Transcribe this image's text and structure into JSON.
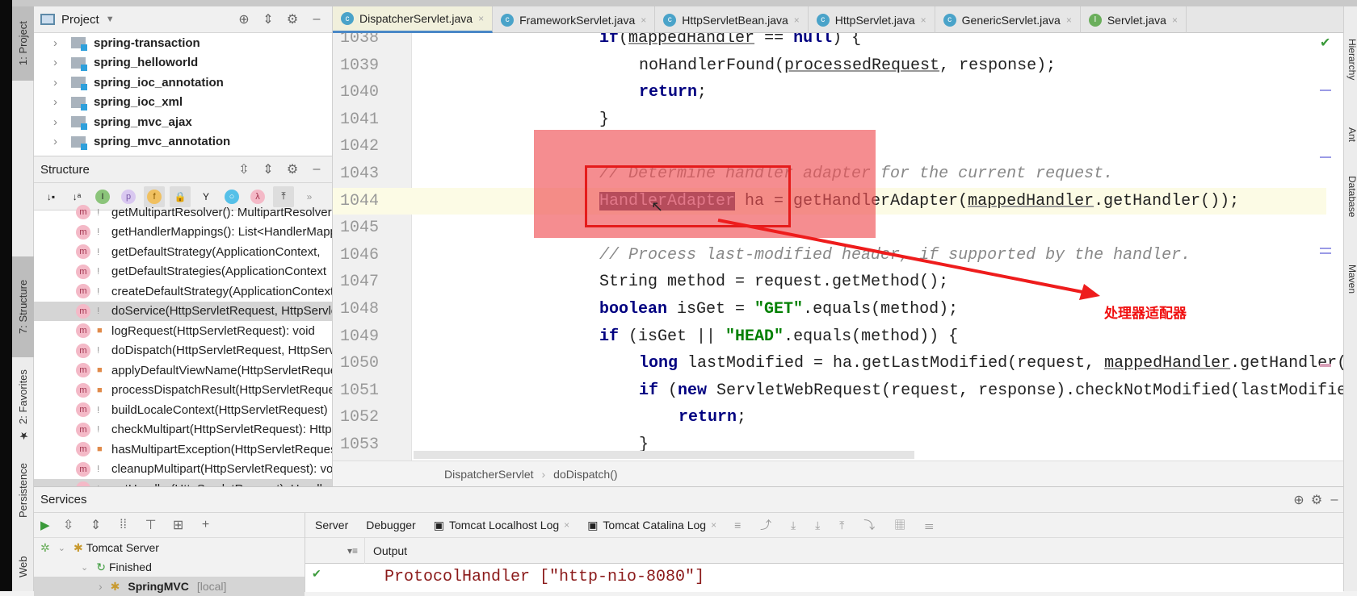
{
  "left_strip": {
    "project": "1: Project",
    "structure": "7: Structure",
    "favorites": "2: Favorites",
    "persistence": "Persistence",
    "web": "Web"
  },
  "right_strip": {
    "hierarchy": "Hierarchy",
    "ant": "Ant",
    "database": "Database",
    "maven": "Maven"
  },
  "project": {
    "title": "Project",
    "items": [
      "spring-transaction",
      "spring_helloworld",
      "spring_ioc_annotation",
      "spring_ioc_xml",
      "spring_mvc_ajax",
      "spring_mvc_annotation"
    ]
  },
  "structure": {
    "title": "Structure",
    "items": [
      {
        "label": "getMultipartResolver(): MultipartResolver",
        "vis": "pkg"
      },
      {
        "label": "getHandlerMappings(): List<HandlerMappings>",
        "vis": "pkg"
      },
      {
        "label": "getDefaultStrategy(ApplicationContext,",
        "vis": "pkg"
      },
      {
        "label": "getDefaultStrategies(ApplicationContext",
        "vis": "pkg"
      },
      {
        "label": "createDefaultStrategy(ApplicationContext",
        "vis": "pkg"
      },
      {
        "label": "doService(HttpServletRequest, HttpServletResponse",
        "vis": "pkg",
        "selected": true
      },
      {
        "label": "logRequest(HttpServletRequest): void",
        "vis": "lock"
      },
      {
        "label": "doDispatch(HttpServletRequest, HttpServletResponse",
        "vis": "pkg"
      },
      {
        "label": "applyDefaultViewName(HttpServletRequest",
        "vis": "lock"
      },
      {
        "label": "processDispatchResult(HttpServletRequest",
        "vis": "lock"
      },
      {
        "label": "buildLocaleContext(HttpServletRequest)",
        "vis": "pkg"
      },
      {
        "label": "checkMultipart(HttpServletRequest): HttpServletRequest",
        "vis": "pkg"
      },
      {
        "label": "hasMultipartException(HttpServletRequest",
        "vis": "lock"
      },
      {
        "label": "cleanupMultipart(HttpServletRequest): void",
        "vis": "pkg"
      },
      {
        "label": "getHandler(HttpServletRequest): HandlerExecutionChain",
        "vis": "pkg",
        "selected": true
      }
    ]
  },
  "tabs": [
    {
      "label": "DispatcherServlet.java",
      "icon": "c",
      "active": true
    },
    {
      "label": "FrameworkServlet.java",
      "icon": "c"
    },
    {
      "label": "HttpServletBean.java",
      "icon": "c"
    },
    {
      "label": "HttpServlet.java",
      "icon": "c"
    },
    {
      "label": "GenericServlet.java",
      "icon": "c"
    },
    {
      "label": "Servlet.java",
      "icon": "I"
    }
  ],
  "editor": {
    "caret_line": 1044,
    "lines": [
      {
        "n": "1038",
        "indent": 0,
        "seg": [
          [
            "kw",
            "if"
          ],
          [
            "",
            "("
          ],
          [
            "ul",
            "mappedHandler"
          ],
          [
            "",
            " == "
          ],
          [
            "kw",
            "null"
          ],
          [
            "",
            ") {"
          ]
        ]
      },
      {
        "n": "1039",
        "indent": 1,
        "seg": [
          [
            "",
            "noHandlerFound("
          ],
          [
            "ul",
            "processedRequest"
          ],
          [
            "",
            ", response);"
          ]
        ]
      },
      {
        "n": "1040",
        "indent": 1,
        "seg": [
          [
            "kw",
            "return"
          ],
          [
            "",
            ";"
          ]
        ]
      },
      {
        "n": "1041",
        "indent": 0,
        "seg": [
          [
            "",
            "}"
          ]
        ]
      },
      {
        "n": "1042",
        "indent": 0,
        "seg": []
      },
      {
        "n": "1043",
        "indent": 0,
        "seg": [
          [
            "cm",
            "// Determine handler adapter for the current request."
          ]
        ]
      },
      {
        "n": "1044",
        "indent": 0,
        "seg": [
          [
            "hl",
            "HandlerAdapter"
          ],
          [
            "",
            " ha = getHandlerAdapter("
          ],
          [
            "ul",
            "mappedHandler"
          ],
          [
            "",
            ".getHandler());"
          ]
        ]
      },
      {
        "n": "1045",
        "indent": 0,
        "seg": []
      },
      {
        "n": "1046",
        "indent": 0,
        "seg": [
          [
            "cm",
            "// Process last-modified header, if supported by the handler."
          ]
        ]
      },
      {
        "n": "1047",
        "indent": 0,
        "seg": [
          [
            "",
            "String method = request.getMethod();"
          ]
        ]
      },
      {
        "n": "1048",
        "indent": 0,
        "seg": [
          [
            "kw",
            "boolean"
          ],
          [
            "",
            " isGet = "
          ],
          [
            "str",
            "\"GET\""
          ],
          [
            "",
            ".equals(method);"
          ]
        ]
      },
      {
        "n": "1049",
        "indent": 0,
        "seg": [
          [
            "kw",
            "if"
          ],
          [
            "",
            " (isGet || "
          ],
          [
            "str",
            "\"HEAD\""
          ],
          [
            "",
            ".equals(method)) {"
          ]
        ]
      },
      {
        "n": "1050",
        "indent": 1,
        "seg": [
          [
            "kw",
            "long"
          ],
          [
            "",
            " lastModified = ha.getLastModified(request, "
          ],
          [
            "ul",
            "mappedHandler"
          ],
          [
            "",
            ".getHandler());"
          ]
        ]
      },
      {
        "n": "1051",
        "indent": 1,
        "seg": [
          [
            "kw",
            "if"
          ],
          [
            "",
            " ("
          ],
          [
            "kw",
            "new"
          ],
          [
            "",
            " ServletWebRequest(request, response).checkNotModified(lastModified"
          ]
        ]
      },
      {
        "n": "1052",
        "indent": 2,
        "seg": [
          [
            "kw",
            "return"
          ],
          [
            "",
            ";"
          ]
        ]
      },
      {
        "n": "1053",
        "indent": 1,
        "seg": [
          [
            "",
            "}"
          ]
        ]
      }
    ]
  },
  "annotation": {
    "text": "处理器适配器",
    "color": "#f01010"
  },
  "breadcrumb": [
    "DispatcherServlet",
    "doDispatch()"
  ],
  "services": {
    "title": "Services",
    "tree": {
      "server": "Tomcat Server",
      "status": "Finished",
      "app": "SpringMVC",
      "app_suffix": "[local]"
    },
    "tabs": [
      "Server",
      "Debugger",
      "Tomcat Localhost Log",
      "Tomcat Catalina Log"
    ],
    "output_label": "Output",
    "output_line": "ProtocolHandler [\"http-nio-8080\"]"
  }
}
